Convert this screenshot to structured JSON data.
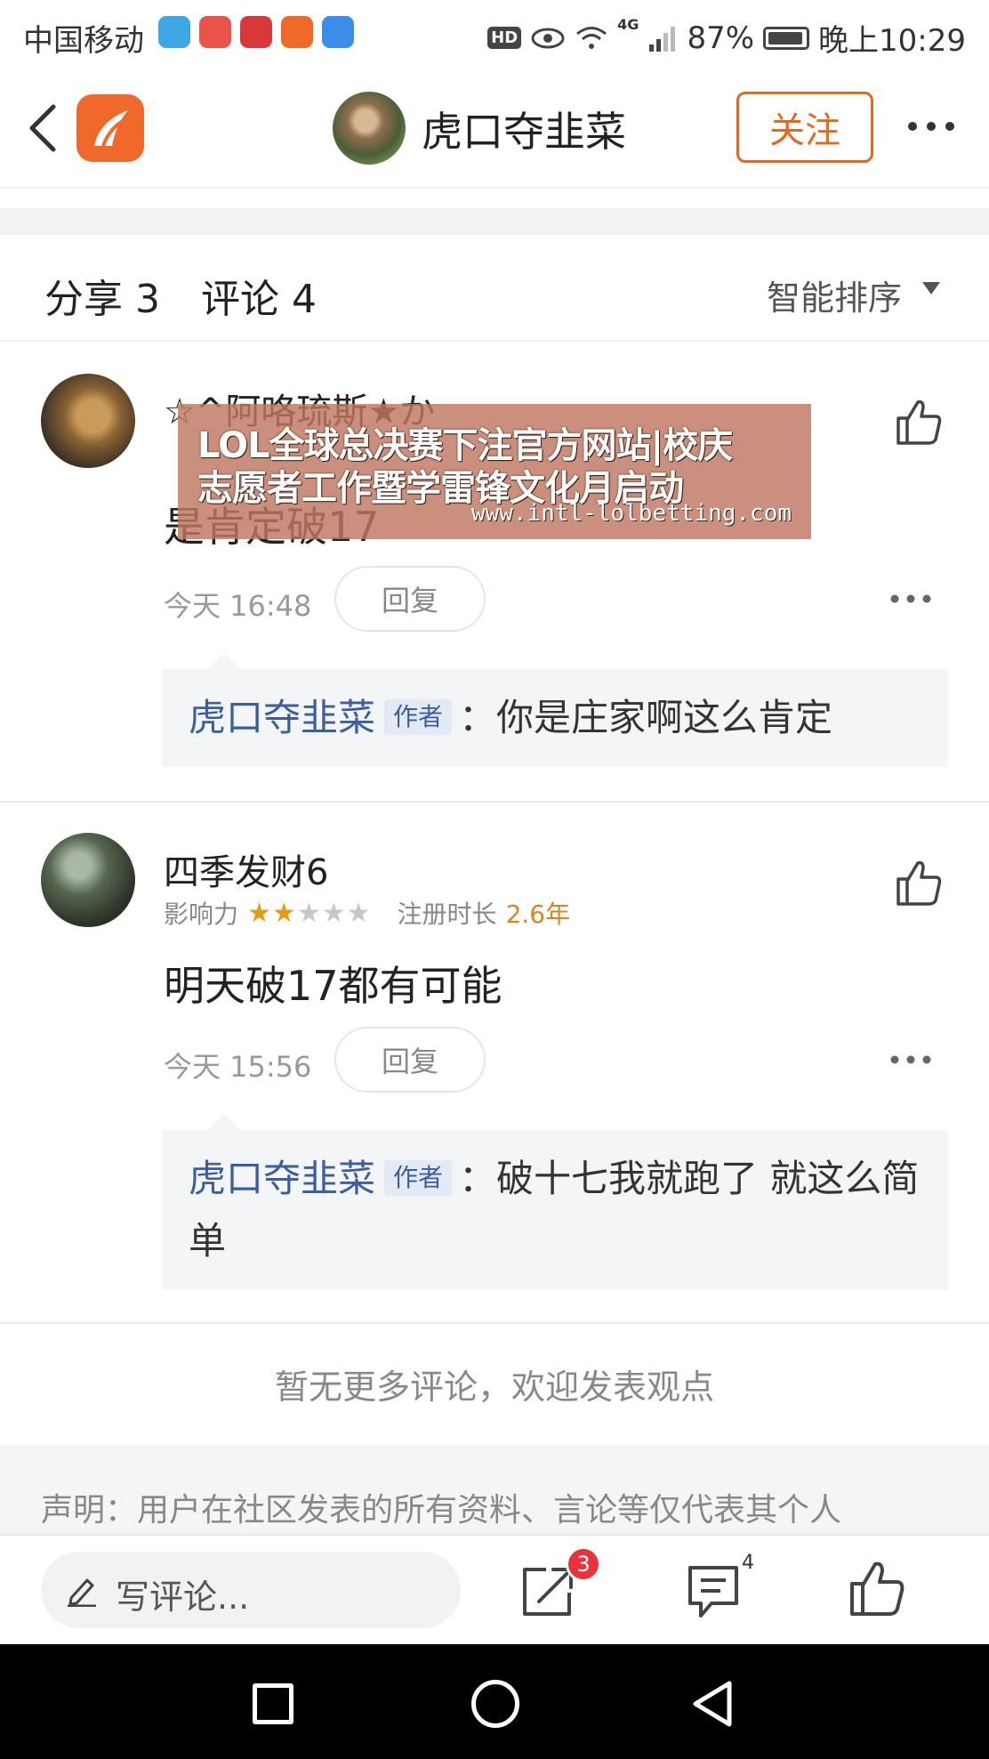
{
  "status_bar": {
    "carrier": "中国移动",
    "battery": "87%",
    "time": "晚上10:29",
    "network": "4G",
    "hd_label": "HD",
    "app_icon_colors": [
      "#3fa7e3",
      "#e8544a",
      "#d8383a",
      "#ef6a2a",
      "#3a8ee8"
    ]
  },
  "nav": {
    "title": "虎口夺韭菜",
    "follow_label": "关注"
  },
  "tabs": {
    "share": "分享 3",
    "comments": "评论 4",
    "sort": "智能排序"
  },
  "comments": [
    {
      "user": "☆^阿咯琉斯★か",
      "text": "是肯定破17",
      "time": "今天 16:48",
      "reply_label": "回复",
      "reply": {
        "author": "虎口夺韭菜",
        "badge": "作者",
        "text": "：你是庄家啊这么肯定"
      }
    },
    {
      "user": "四季发财6",
      "influence_label": "影响力",
      "stars_filled": 2,
      "stars_total": 5,
      "reg_label": "注册时长",
      "reg_value": "2.6年",
      "text": "明天破17都有可能",
      "time": "今天 15:56",
      "reply_label": "回复",
      "reply": {
        "author": "虎口夺韭菜",
        "badge": "作者",
        "text": "：破十七我就跑了 就这么简单"
      }
    }
  ],
  "no_more": "暂无更多评论，欢迎发表观点",
  "disclaimer": "声明：用户在社区发表的所有资料、言论等仅代表其个人",
  "overlay_ad": {
    "line1": "LOL全球总决赛下注官方网站|校庆",
    "line2": "志愿者工作暨学雷锋文化月启动",
    "url": "www.intl-lolbetting.com"
  },
  "action_bar": {
    "write_placeholder": "写评论...",
    "share_badge": "3",
    "comment_count": "4"
  },
  "colors": {
    "accent_orange": "#e06a1f",
    "author_blue": "#3b5f9e",
    "star_gold": "#e39b17",
    "badge_red": "#e8323c"
  }
}
